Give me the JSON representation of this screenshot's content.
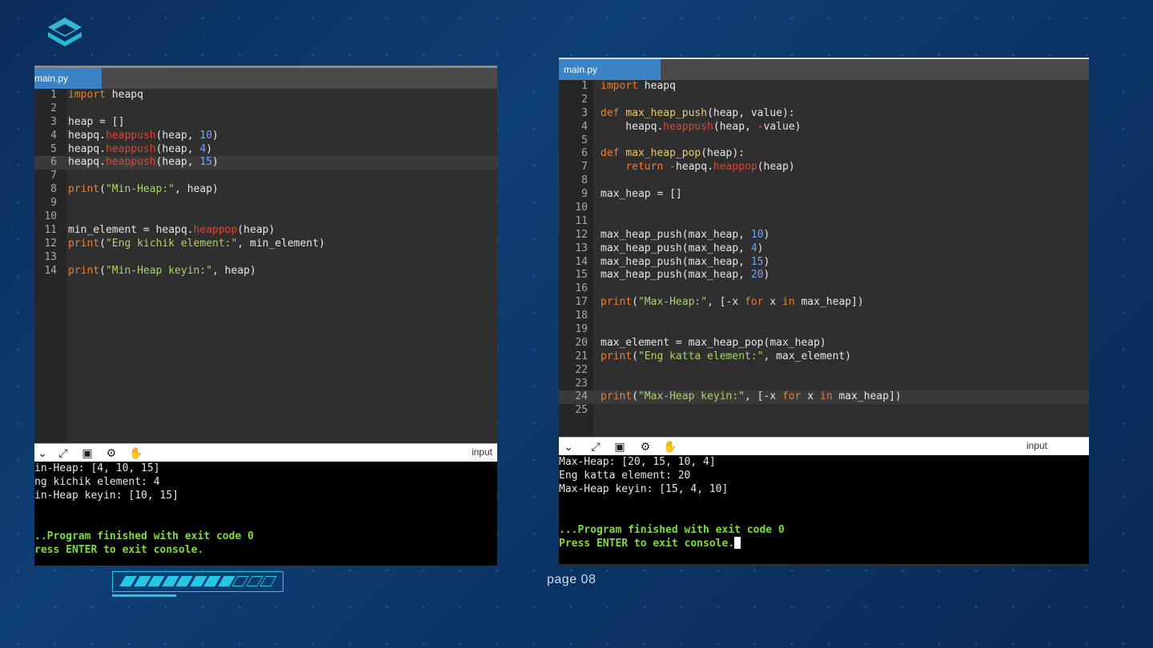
{
  "slide": {
    "page_label": "page 08",
    "progress_filled": 8,
    "progress_total": 11
  },
  "left": {
    "tab": "main.py",
    "lines": [
      [
        {
          "t": "import ",
          "c": "k"
        },
        {
          "t": "heapq"
        }
      ],
      [],
      [
        {
          "t": "heap = []"
        }
      ],
      [
        {
          "t": "heapq."
        },
        {
          "t": "heappush",
          "c": "fn"
        },
        {
          "t": "(heap, "
        },
        {
          "t": "10",
          "c": "n"
        },
        {
          "t": ")"
        }
      ],
      [
        {
          "t": "heapq."
        },
        {
          "t": "heappush",
          "c": "fn"
        },
        {
          "t": "(heap, "
        },
        {
          "t": "4",
          "c": "n"
        },
        {
          "t": ")"
        }
      ],
      [
        {
          "t": "heapq."
        },
        {
          "t": "heappush",
          "c": "fn"
        },
        {
          "t": "(heap, "
        },
        {
          "t": "15",
          "c": "n"
        },
        {
          "t": ")"
        }
      ],
      [],
      [
        {
          "t": "print",
          "c": "k"
        },
        {
          "t": "("
        },
        {
          "t": "\"Min-Heap:\"",
          "c": "s"
        },
        {
          "t": ", heap)"
        }
      ],
      [],
      [],
      [
        {
          "t": "min_element = heapq."
        },
        {
          "t": "heappop",
          "c": "fn"
        },
        {
          "t": "(heap)"
        }
      ],
      [
        {
          "t": "print",
          "c": "k"
        },
        {
          "t": "("
        },
        {
          "t": "\"Eng kichik element:\"",
          "c": "s"
        },
        {
          "t": ", min_element)"
        }
      ],
      [],
      [
        {
          "t": "print",
          "c": "k"
        },
        {
          "t": "("
        },
        {
          "t": "\"Min-Heap keyin:\"",
          "c": "s"
        },
        {
          "t": ", heap)"
        }
      ]
    ],
    "active_line": 6,
    "toolbar_label": "input",
    "console": [
      "in-Heap: [4, 10, 15]",
      "ng kichik element: 4",
      "in-Heap keyin: [10, 15]",
      "",
      ""
    ],
    "console_status": [
      "..Program finished with exit code 0",
      "ress ENTER to exit console."
    ]
  },
  "right": {
    "tab": "main.py",
    "lines": [
      [
        {
          "t": "import ",
          "c": "k"
        },
        {
          "t": "heapq"
        }
      ],
      [],
      [
        {
          "t": "def ",
          "c": "k"
        },
        {
          "t": "max_heap_push",
          "c": "d"
        },
        {
          "t": "(heap, value):"
        }
      ],
      [
        {
          "t": "    heapq."
        },
        {
          "t": "heappush",
          "c": "fn"
        },
        {
          "t": "(heap, "
        },
        {
          "t": "-",
          "c": "k"
        },
        {
          "t": "value)"
        }
      ],
      [],
      [
        {
          "t": "def ",
          "c": "k"
        },
        {
          "t": "max_heap_pop",
          "c": "d"
        },
        {
          "t": "(heap):"
        }
      ],
      [
        {
          "t": "    "
        },
        {
          "t": "return ",
          "c": "k"
        },
        {
          "t": "-",
          "c": "k"
        },
        {
          "t": "heapq."
        },
        {
          "t": "heappop",
          "c": "fn"
        },
        {
          "t": "(heap)"
        }
      ],
      [],
      [
        {
          "t": "max_heap = []"
        }
      ],
      [],
      [],
      [
        {
          "t": "max_heap_push(max_heap, "
        },
        {
          "t": "10",
          "c": "n"
        },
        {
          "t": ")"
        }
      ],
      [
        {
          "t": "max_heap_push(max_heap, "
        },
        {
          "t": "4",
          "c": "n"
        },
        {
          "t": ")"
        }
      ],
      [
        {
          "t": "max_heap_push(max_heap, "
        },
        {
          "t": "15",
          "c": "n"
        },
        {
          "t": ")"
        }
      ],
      [
        {
          "t": "max_heap_push(max_heap, "
        },
        {
          "t": "20",
          "c": "n"
        },
        {
          "t": ")"
        }
      ],
      [],
      [
        {
          "t": "print",
          "c": "k"
        },
        {
          "t": "("
        },
        {
          "t": "\"Max-Heap:\"",
          "c": "s"
        },
        {
          "t": ", [-x "
        },
        {
          "t": "for ",
          "c": "k"
        },
        {
          "t": "x "
        },
        {
          "t": "in ",
          "c": "k"
        },
        {
          "t": "max_heap])"
        }
      ],
      [],
      [],
      [
        {
          "t": "max_element = max_heap_pop(max_heap)"
        }
      ],
      [
        {
          "t": "print",
          "c": "k"
        },
        {
          "t": "("
        },
        {
          "t": "\"Eng katta element:\"",
          "c": "s"
        },
        {
          "t": ", max_element)"
        }
      ],
      [],
      [],
      [
        {
          "t": "print",
          "c": "k"
        },
        {
          "t": "("
        },
        {
          "t": "\"Max-Heap keyin:\"",
          "c": "s"
        },
        {
          "t": ", [-x "
        },
        {
          "t": "for ",
          "c": "k"
        },
        {
          "t": "x "
        },
        {
          "t": "in ",
          "c": "k"
        },
        {
          "t": "max_heap])"
        }
      ],
      []
    ],
    "active_line": 24,
    "toolbar_label": "input",
    "console": [
      "Max-Heap: [20, 15, 10, 4]",
      "Eng katta element: 20",
      "Max-Heap keyin: [15, 4, 10]",
      "",
      ""
    ],
    "console_status": [
      "...Program finished with exit code 0",
      "Press ENTER to exit console."
    ]
  },
  "colors": {
    "accent_cyan": "#27c5e6",
    "tab_blue": "#3b83c4",
    "console_green": "#7ddc3a"
  }
}
